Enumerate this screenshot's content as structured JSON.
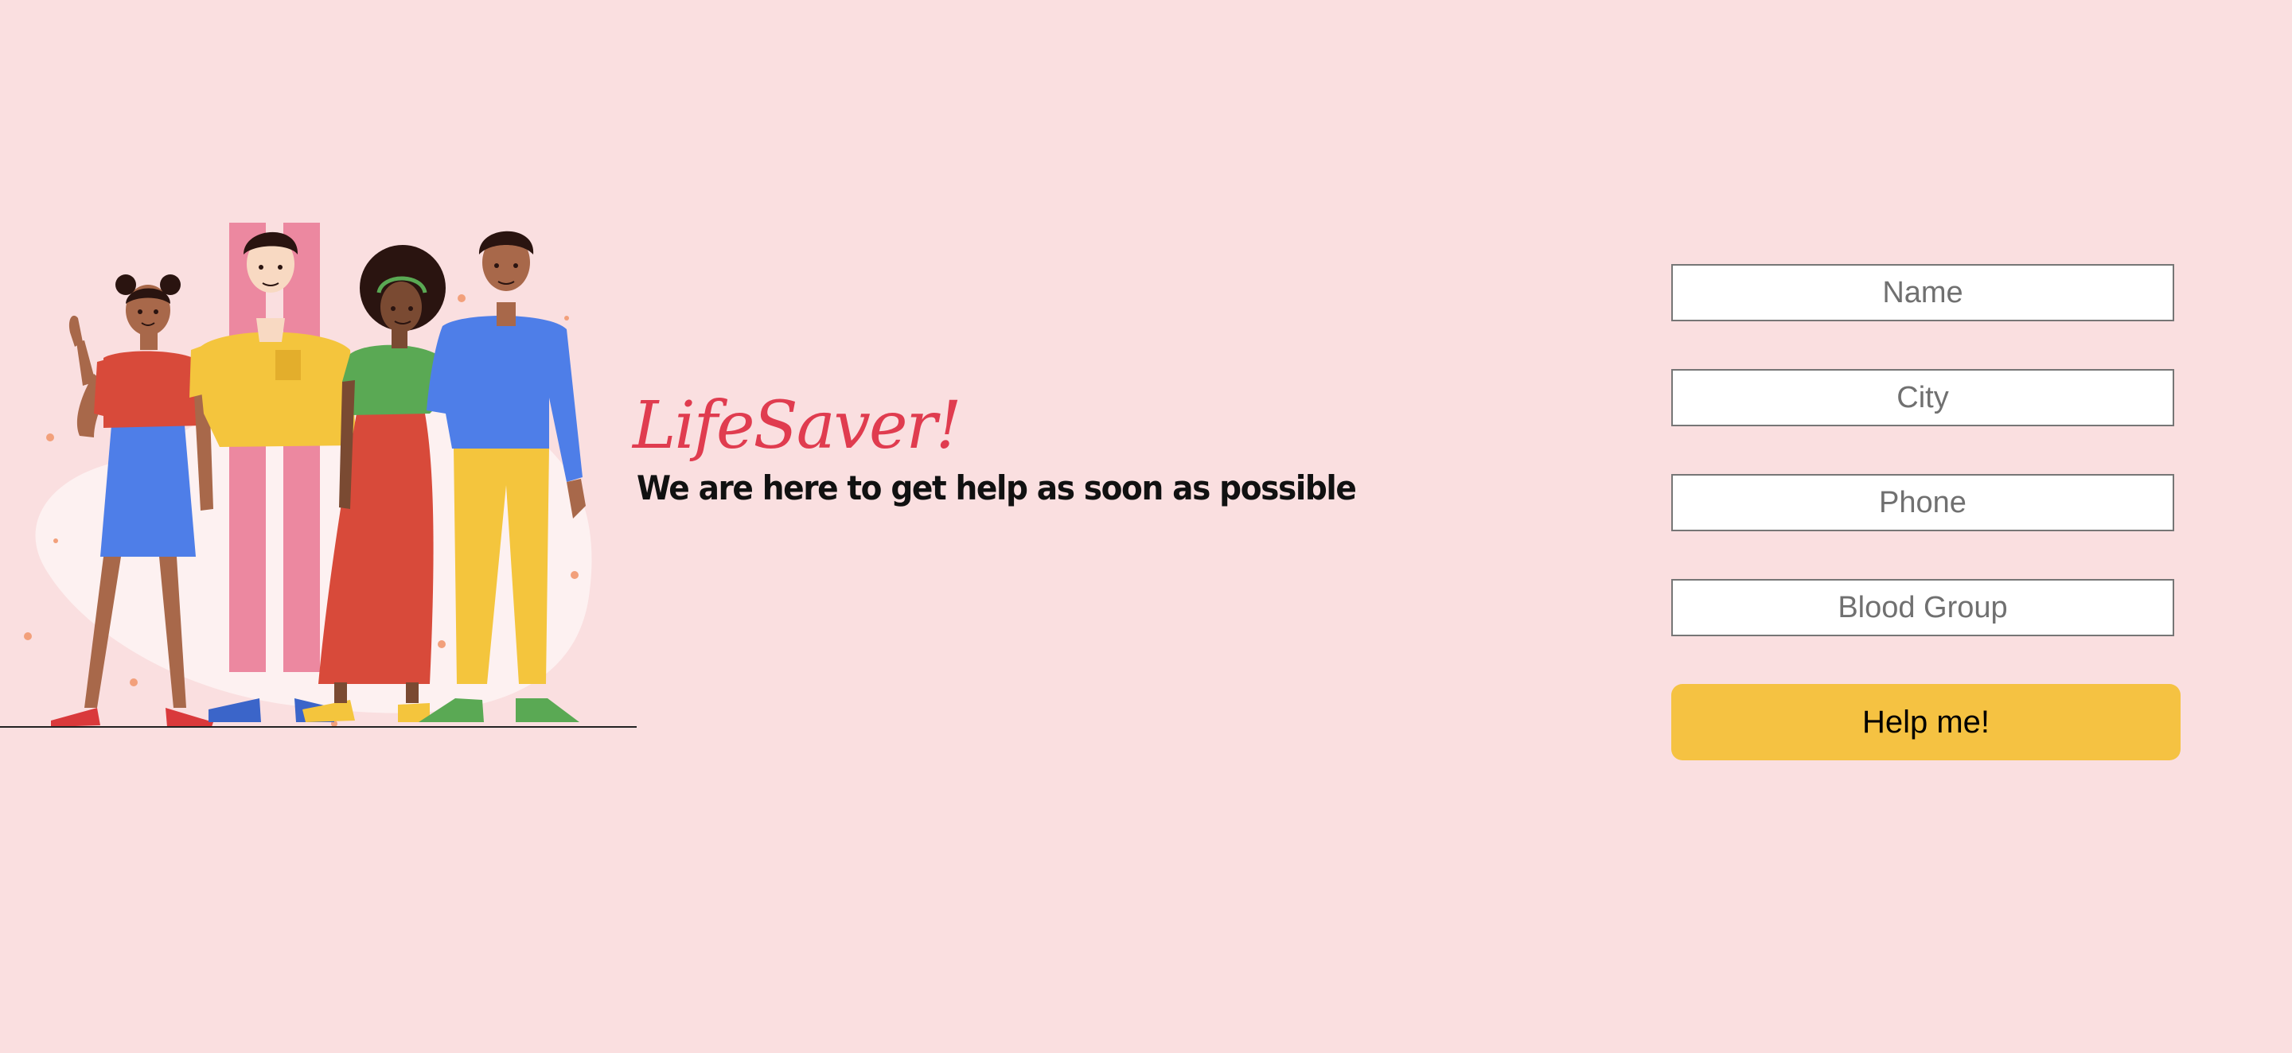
{
  "hero": {
    "brand": "LifeSaver!",
    "tagline": "We are here to get help as soon as possible",
    "illustration": "group-of-four-people-illustration"
  },
  "form": {
    "name_placeholder": "Name",
    "city_placeholder": "City",
    "phone_placeholder": "Phone",
    "blood_group_placeholder": "Blood Group",
    "submit_label": "Help me!"
  },
  "colors": {
    "background": "#fadfe0",
    "brand": "#e03c4f",
    "button": "#f5c242"
  }
}
